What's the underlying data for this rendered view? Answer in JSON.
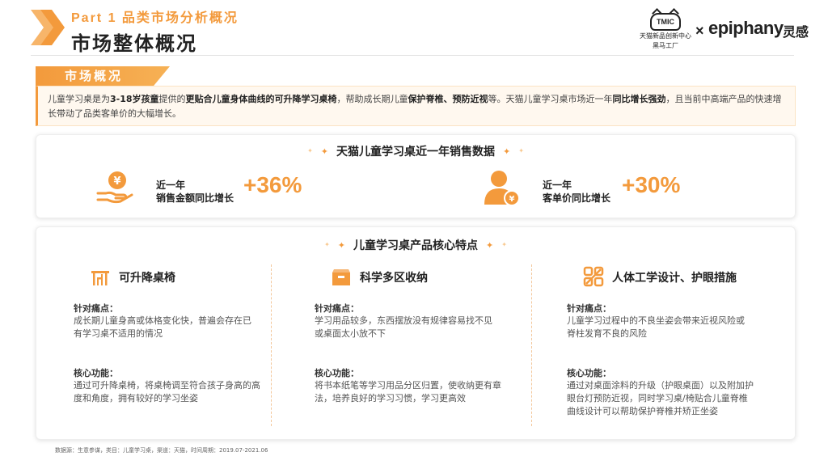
{
  "header": {
    "part_label": "Part 1 品类市场分析概况",
    "title": "市场整体概况",
    "logo_tmic_text": "TMIC",
    "logo_tmic_sub1": "天猫新品创新中心",
    "logo_tmic_sub2": "黑马工厂",
    "logo_x": "×",
    "logo_epiphany": "epiphany",
    "logo_lg": "灵感"
  },
  "overview": {
    "tab_label": "市场概况",
    "seg1": "儿童学习桌是为",
    "seg2": "3-18岁孩童",
    "seg3": "提供的",
    "seg4": "更贴合儿童身体曲线的可升降学习桌椅",
    "seg5": "，帮助成长期儿童",
    "seg6": "保护脊椎、预防近视",
    "seg7": "等。天猫儿童学习桌市场近一年",
    "seg8": "同比增长强劲",
    "seg9": "，且当前中高端产品的快速增长带动了品类客单价的大幅增长。"
  },
  "sales": {
    "heading": "天猫儿童学习桌近一年销售数据",
    "stats": [
      {
        "line1": "近一年",
        "line2": "销售金额同比增长",
        "value": "+36%",
        "icon": "money-hand-icon"
      },
      {
        "line1": "近一年",
        "line2": "客单价同比增长",
        "value": "+30%",
        "icon": "user-yuan-icon"
      }
    ]
  },
  "features": {
    "heading": "儿童学习桌产品核心特点",
    "pain_label": "针对痛点：",
    "core_label": "核心功能：",
    "items": [
      {
        "title": "可升降桌椅",
        "icon": "desk-chair-icon",
        "pain": "成长期儿童身高或体格变化快，普遍会存在已有学习桌不适用的情况",
        "core": "通过可升降桌椅，将桌椅调至符合孩子身高的高度和角度，拥有较好的学习坐姿"
      },
      {
        "title": "科学多区收纳",
        "icon": "storage-box-icon",
        "pain": "学习用品较多，东西摆放没有规律容易找不见或桌面太小放不下",
        "core": "将书本纸笔等学习用品分区归置，使收纳更有章法，培养良好的学习习惯，学习更高效"
      },
      {
        "title": "人体工学设计、护眼措施",
        "icon": "ergonomic-icon",
        "pain": "儿童学习过程中的不良坐姿会带来近视风险或脊柱发育不良的风险",
        "core": "通过对桌面涂料的升级（护眼桌面）以及附加护眼台灯预防近视，同时学习桌/椅贴合儿童脊椎曲线设计可以帮助保护脊椎并矫正坐姿"
      }
    ]
  },
  "footer": {
    "source": "数据源：生意参谋，类目：儿童学习桌，渠道：天猫，时间周期：2019.07-2021.06"
  },
  "colors": {
    "accent": "#f39a3c",
    "light_bg": "#fff8ef"
  }
}
